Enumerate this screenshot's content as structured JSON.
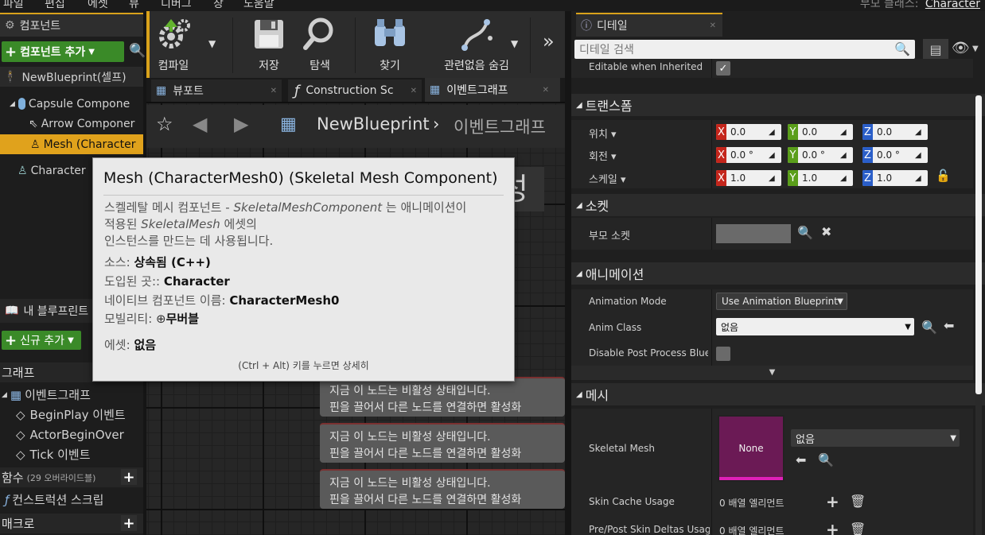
{
  "menu": [
    "파일",
    "편집",
    "에셋",
    "뷰",
    "디버그",
    "창",
    "도움말"
  ],
  "parent_class": {
    "label": "부모 클래스:",
    "value": "Character"
  },
  "components_panel": {
    "tab_title": "컴포넌트",
    "add_button": "컴포넌트 추가",
    "self_item": "NewBlueprint(셀프)",
    "tree": [
      "Capsule Compone",
      "Arrow Componer",
      "Mesh (Character",
      "Character"
    ]
  },
  "my_blueprint": {
    "tab_title": "내 블루프린트",
    "add_new": "신규 추가",
    "graph_header": "그래프",
    "event_graph": "이벤트그래프",
    "events": [
      "BeginPlay 이벤트",
      "ActorBeginOver",
      "Tick 이벤트"
    ],
    "functions_header": "함수",
    "functions_note": "(29 오버라이드블)",
    "construction": "컨스트럭션 스크립",
    "macros_header": "매크로"
  },
  "toolbar": {
    "compile": "컴파일",
    "save": "저장",
    "browse": "탐색",
    "find": "찾기",
    "hide_unrelated": "관련없음 숨김"
  },
  "editor_tabs": [
    "뷰포트",
    "Construction Sc",
    "이벤트그래프"
  ],
  "breadcrumb": {
    "root": "NewBlueprint",
    "current": "이벤트그래프"
  },
  "graph": {
    "big_glyph": "성",
    "disabled_node_line1": "지금 이 노드는 비활성 상태입니다.",
    "disabled_node_line2": "핀을 끌어서 다른 노드를 연결하면 활성화"
  },
  "details": {
    "tab_title": "디테일",
    "search_placeholder": "디테일 검색",
    "editable_label": "Editable when Inherited",
    "transform_header": "트랜스폼",
    "location": {
      "label": "위치",
      "x": "0.0",
      "y": "0.0",
      "z": "0.0"
    },
    "rotation": {
      "label": "회전",
      "x": "0.0 °",
      "y": "0.0 °",
      "z": "0.0 °"
    },
    "scale": {
      "label": "스케일",
      "x": "1.0",
      "y": "1.0",
      "z": "1.0"
    },
    "sockets_header": "소켓",
    "parent_socket_label": "부모 소켓",
    "animation_header": "애니메이션",
    "anim_mode_label": "Animation Mode",
    "anim_mode_value": "Use Animation Blueprint",
    "anim_class_label": "Anim Class",
    "anim_class_value": "없음",
    "disable_pp_label": "Disable Post Process Bluep",
    "mesh_header": "메시",
    "skeletal_mesh_label": "Skeletal Mesh",
    "skeletal_mesh_thumb": "None",
    "skeletal_mesh_value": "없음",
    "skin_cache_label": "Skin Cache Usage",
    "skin_cache_value": "0 배열 엘리먼트",
    "pre_post_label": "Pre/Post Skin Deltas Usag",
    "pre_post_value": "0 배열 엘리먼트"
  },
  "tooltip": {
    "title": "Mesh (CharacterMesh0) (Skeletal Mesh Component)",
    "desc_1a": "스켈레탈 메시 컴포넌트 - ",
    "desc_1b": "SkeletalMeshComponent",
    "desc_1c": " 는 애니메이션이",
    "desc_2a": "적용된 ",
    "desc_2b": "SkeletalMesh",
    "desc_2c": " 에셋의",
    "desc_3": "인스턴스를 만드는 데 사용됩니다.",
    "source_label": "소스:",
    "source_value": "상속됨 (C++)",
    "introduced_label": "도입된 곳::",
    "introduced_value": "Character",
    "native_label": "네이티브 컴포넌트 이름:",
    "native_value": "CharacterMesh0",
    "mobility_label": "모빌리티:",
    "mobility_value": "무버블",
    "asset_label": "에셋:",
    "asset_value": "없음",
    "hint": "(Ctrl + Alt) 키를 누르면 상세히"
  },
  "colors": {
    "accent": "#e0a21c",
    "green": "#3a8a28",
    "x_axis": "#c4261c",
    "y_axis": "#5a9e1a",
    "z_axis": "#2a5ec8",
    "mesh_thumb": "#6b1a55"
  }
}
